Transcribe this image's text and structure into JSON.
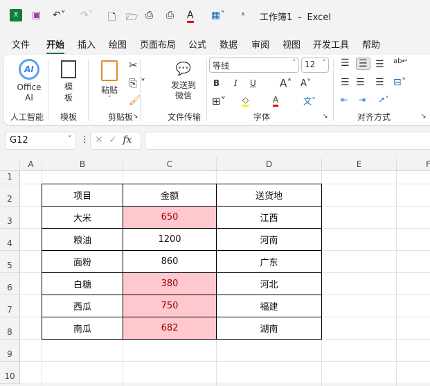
{
  "qat": {
    "title": "工作簿1  -  Excel"
  },
  "menu": [
    "文件",
    "开始",
    "插入",
    "绘图",
    "页面布局",
    "公式",
    "数据",
    "审阅",
    "视图",
    "开发工具",
    "帮助"
  ],
  "ribbon": {
    "office_ai": "Office AI",
    "ai_badge": "AI",
    "group_ai": "人工智能",
    "template": "模板",
    "group_template": "模板",
    "paste": "粘贴",
    "group_clipboard": "剪贴板",
    "send_wechat": "发送到微信",
    "group_transfer": "文件传输",
    "font_name": "等线",
    "font_size": "12",
    "bold": "B",
    "italic": "I",
    "underline": "U",
    "group_font": "字体",
    "group_align": "对齐方式"
  },
  "formula_bar": {
    "name_box": "G12",
    "fx": "fx",
    "value": ""
  },
  "columns": [
    "A",
    "B",
    "C",
    "D",
    "E",
    "F"
  ],
  "rows": [
    "1",
    "2",
    "3",
    "4",
    "5",
    "6",
    "7",
    "8",
    "9",
    "10"
  ],
  "table": {
    "headers": [
      "项目",
      "金额",
      "送货地"
    ],
    "rows": [
      {
        "item": "大米",
        "amount": "650",
        "place": "江西",
        "highlight": true
      },
      {
        "item": "粮油",
        "amount": "1200",
        "place": "河南",
        "highlight": false
      },
      {
        "item": "面粉",
        "amount": "860",
        "place": "广东",
        "highlight": false
      },
      {
        "item": "白糖",
        "amount": "380",
        "place": "河北",
        "highlight": true
      },
      {
        "item": "西瓜",
        "amount": "750",
        "place": "福建",
        "highlight": true
      },
      {
        "item": "南瓜",
        "amount": "682",
        "place": "湖南",
        "highlight": true
      }
    ]
  },
  "colors": {
    "highlight_fill": "#ffc7ce",
    "highlight_text": "#9c0006",
    "excel_green": "#1e7145"
  }
}
